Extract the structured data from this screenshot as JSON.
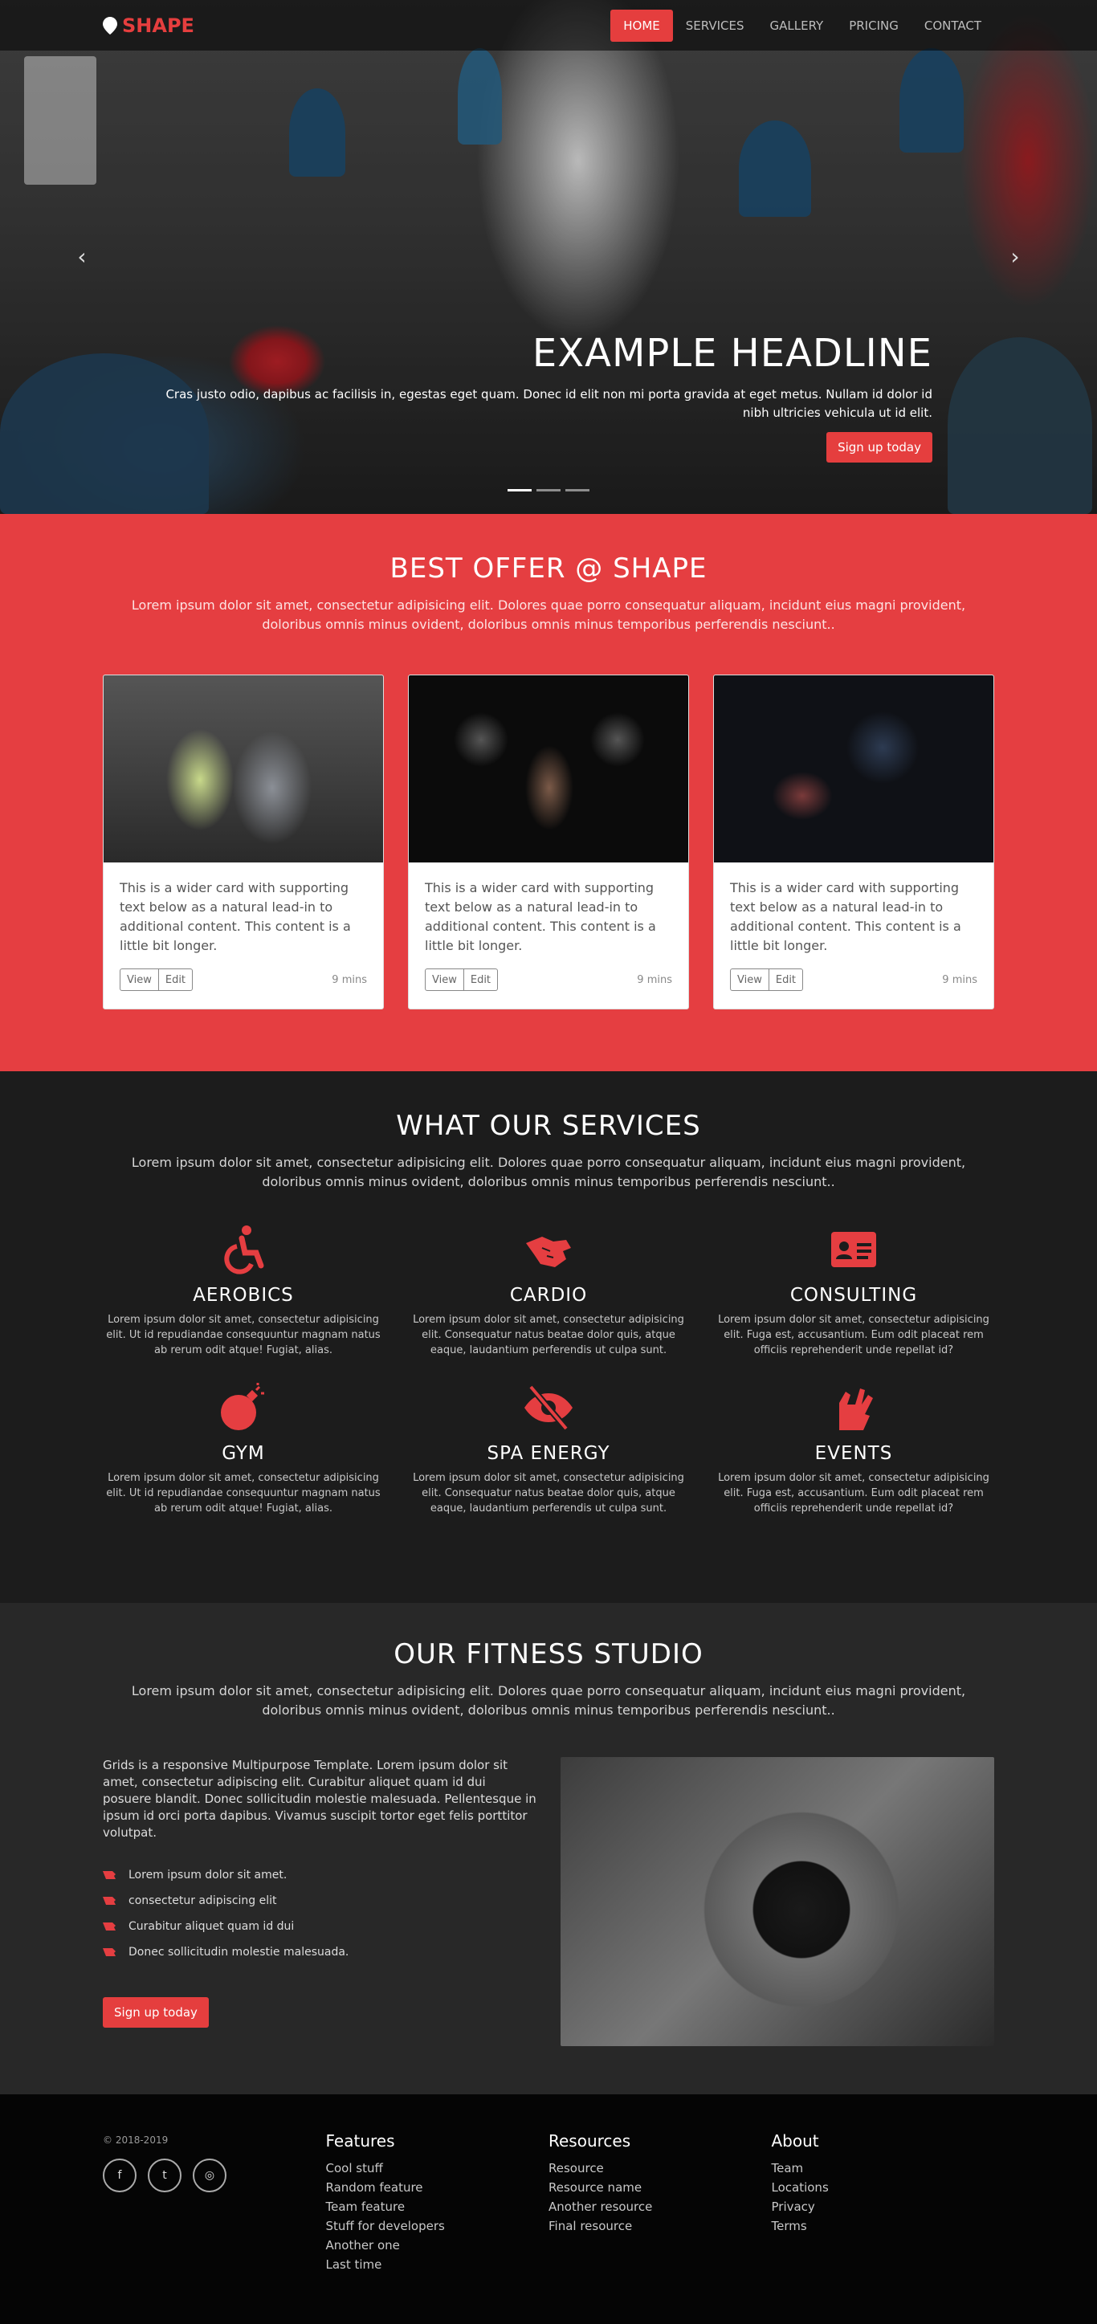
{
  "nav": {
    "brand": "SHAPE",
    "items": [
      "HOME",
      "SERVICES",
      "GALLERY",
      "PRICING",
      "CONTACT"
    ],
    "active": "HOME"
  },
  "hero": {
    "headline": "EXAMPLE HEADLINE",
    "text": "Cras justo odio, dapibus ac facilisis in, egestas eget quam. Donec id elit non mi porta gravida at eget metus. Nullam id dolor id nibh ultricies vehicula ut id elit.",
    "cta": "Sign up today",
    "slides": 3,
    "active_slide": 1
  },
  "offer": {
    "title": "BEST OFFER @ SHAPE",
    "lead": "Lorem ipsum dolor sit amet, consectetur adipisicing elit. Dolores quae porro consequatur aliquam, incidunt eius magni provident, doloribus omnis minus ovident, doloribus omnis minus temporibus perferendis nesciunt..",
    "cards": [
      {
        "text": "This is a wider card with supporting text below as a natural lead-in to additional content. This content is a little bit longer.",
        "view": "View",
        "edit": "Edit",
        "time": "9 mins"
      },
      {
        "text": "This is a wider card with supporting text below as a natural lead-in to additional content. This content is a little bit longer.",
        "view": "View",
        "edit": "Edit",
        "time": "9 mins"
      },
      {
        "text": "This is a wider card with supporting text below as a natural lead-in to additional content. This content is a little bit longer.",
        "view": "View",
        "edit": "Edit",
        "time": "9 mins"
      }
    ]
  },
  "services": {
    "title": "WHAT OUR SERVICES",
    "lead": "Lorem ipsum dolor sit amet, consectetur adipisicing elit. Dolores quae porro consequatur aliquam, incidunt eius magni provident, doloribus omnis minus ovident, doloribus omnis minus temporibus perferendis nesciunt..",
    "items": [
      {
        "icon": "wheelchair-icon",
        "name": "AEROBICS",
        "text": "Lorem ipsum dolor sit amet, consectetur adipisicing elit. Ut id repudiandae consequuntur magnam natus ab rerum odit atque! Fugiat, alias."
      },
      {
        "icon": "sign-language-icon",
        "name": "CARDIO",
        "text": "Lorem ipsum dolor sit amet, consectetur adipisicing elit. Consequatur natus beatae dolor quis, atque eaque, laudantium perferendis ut culpa sunt."
      },
      {
        "icon": "id-card-icon",
        "name": "CONSULTING",
        "text": "Lorem ipsum dolor sit amet, consectetur adipisicing elit. Fuga est, accusantium. Eum odit placeat rem officiis reprehenderit unde repellat id?"
      },
      {
        "icon": "bomb-icon",
        "name": "GYM",
        "text": "Lorem ipsum dolor sit amet, consectetur adipisicing elit. Ut id repudiandae consequuntur magnam natus ab rerum odit atque! Fugiat, alias."
      },
      {
        "icon": "eye-slash-icon",
        "name": "SPA ENERGY",
        "text": "Lorem ipsum dolor sit amet, consectetur adipisicing elit. Consequatur natus beatae dolor quis, atque eaque, laudantium perferendis ut culpa sunt."
      },
      {
        "icon": "hands-icon",
        "name": "EVENTS",
        "text": "Lorem ipsum dolor sit amet, consectetur adipisicing elit. Fuga est, accusantium. Eum odit placeat rem officiis reprehenderit unde repellat id?"
      }
    ]
  },
  "studio": {
    "title": "OUR FITNESS STUDIO",
    "lead": "Lorem ipsum dolor sit amet, consectetur adipisicing elit. Dolores quae porro consequatur aliquam, incidunt eius magni provident, doloribus omnis minus ovident, doloribus omnis minus temporibus perferendis nesciunt..",
    "text": "Grids is a responsive Multipurpose Template. Lorem ipsum dolor sit amet, consectetur adipiscing elit. Curabitur aliquet quam id dui posuere blandit. Donec sollicitudin molestie malesuada. Pellentesque in ipsum id orci porta dapibus. Vivamus suscipit tortor eget felis porttitor volutpat.",
    "list": [
      "Lorem ipsum dolor sit amet.",
      "consectetur adipiscing elit",
      "Curabitur aliquet quam id dui",
      "Donec sollicitudin molestie malesuada."
    ],
    "cta": "Sign up today"
  },
  "footer": {
    "copy": "© 2018-2019",
    "socials": [
      "facebook-icon",
      "twitter-icon",
      "instagram-icon"
    ],
    "columns": [
      {
        "title": "Features",
        "links": [
          "Cool stuff",
          "Random feature",
          "Team feature",
          "Stuff for developers",
          "Another one",
          "Last time"
        ]
      },
      {
        "title": "Resources",
        "links": [
          "Resource",
          "Resource name",
          "Another resource",
          "Final resource"
        ]
      },
      {
        "title": "About",
        "links": [
          "Team",
          "Locations",
          "Privacy",
          "Terms"
        ]
      }
    ]
  },
  "colors": {
    "accent": "#e53e41",
    "dark": "#1c1c1c",
    "darker": "#282828",
    "footer": "#050505"
  }
}
